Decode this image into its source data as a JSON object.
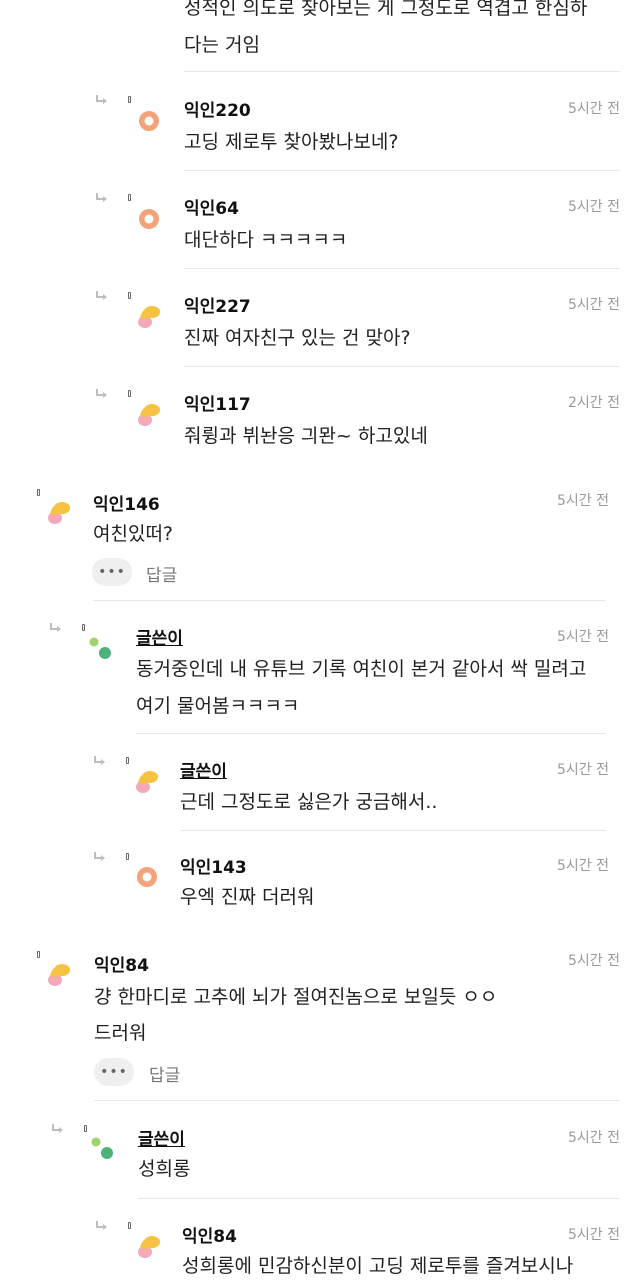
{
  "icons": {
    "reply": "reply-arrow-icon",
    "more": "more-dots-icon",
    "avatar_orange": "orange-ring-avatar-icon",
    "avatar_yellow": "yellow-pink-blob-avatar-icon",
    "avatar_green": "green-dots-avatar-icon"
  },
  "colors": {
    "orange": "#f4a277",
    "yellow": "#f5c242",
    "pink": "#f3a9b8",
    "green": "#4fb07a",
    "lime": "#9ed46b"
  },
  "ui": {
    "more_label": "•••",
    "reply_label": "답글"
  },
  "comments": [
    {
      "id": "c0",
      "name": "",
      "time": "",
      "lines": [
        "성적인 의도로 찾아보는 게 그정도로 역겹고 한심하",
        "다는 거임"
      ]
    },
    {
      "id": "c1",
      "name": "익인220",
      "time": "5시간 전",
      "lines": [
        "고딩 제로투 찾아봤나보네?"
      ]
    },
    {
      "id": "c2",
      "name": "익인64",
      "time": "5시간 전",
      "lines": [
        "대단하다 ㅋㅋㅋㅋㅋ"
      ]
    },
    {
      "id": "c3",
      "name": "익인227",
      "time": "5시간 전",
      "lines": [
        "진짜 여자친구 있는 건 맞아?"
      ]
    },
    {
      "id": "c4",
      "name": "익인117",
      "time": "2시간 전",
      "lines": [
        "줘륑과 뷔놘응 긔뫈~ 하고있네"
      ]
    },
    {
      "id": "c5",
      "name": "익인146",
      "time": "5시간 전",
      "lines": [
        "여친있떠?"
      ]
    },
    {
      "id": "c6",
      "name": "글쓴이",
      "time": "5시간 전",
      "lines": [
        "동거중인데 내 유튜브 기록 여친이 본거 같아서 싹 밀려고",
        "여기 물어봄ㅋㅋㅋㅋ"
      ]
    },
    {
      "id": "c7",
      "name": "글쓴이",
      "time": "5시간 전",
      "lines": [
        "근데 그정도로 싫은가 궁금해서.."
      ]
    },
    {
      "id": "c8",
      "name": "익인143",
      "time": "5시간 전",
      "lines": [
        "우엑 진짜 더러워"
      ]
    },
    {
      "id": "c9",
      "name": "익인84",
      "time": "5시간 전",
      "lines": [
        "걍 한마디로 고추에 뇌가 절여진놈으로 보일듯 ㅇㅇ",
        "드러워"
      ]
    },
    {
      "id": "c10",
      "name": "글쓴이",
      "time": "5시간 전",
      "lines": [
        "성희롱"
      ]
    },
    {
      "id": "c11",
      "name": "익인84",
      "time": "5시간 전",
      "lines": [
        "성희롱에 민감하신분이 고딩 제로투를 즐겨보시나"
      ]
    }
  ]
}
